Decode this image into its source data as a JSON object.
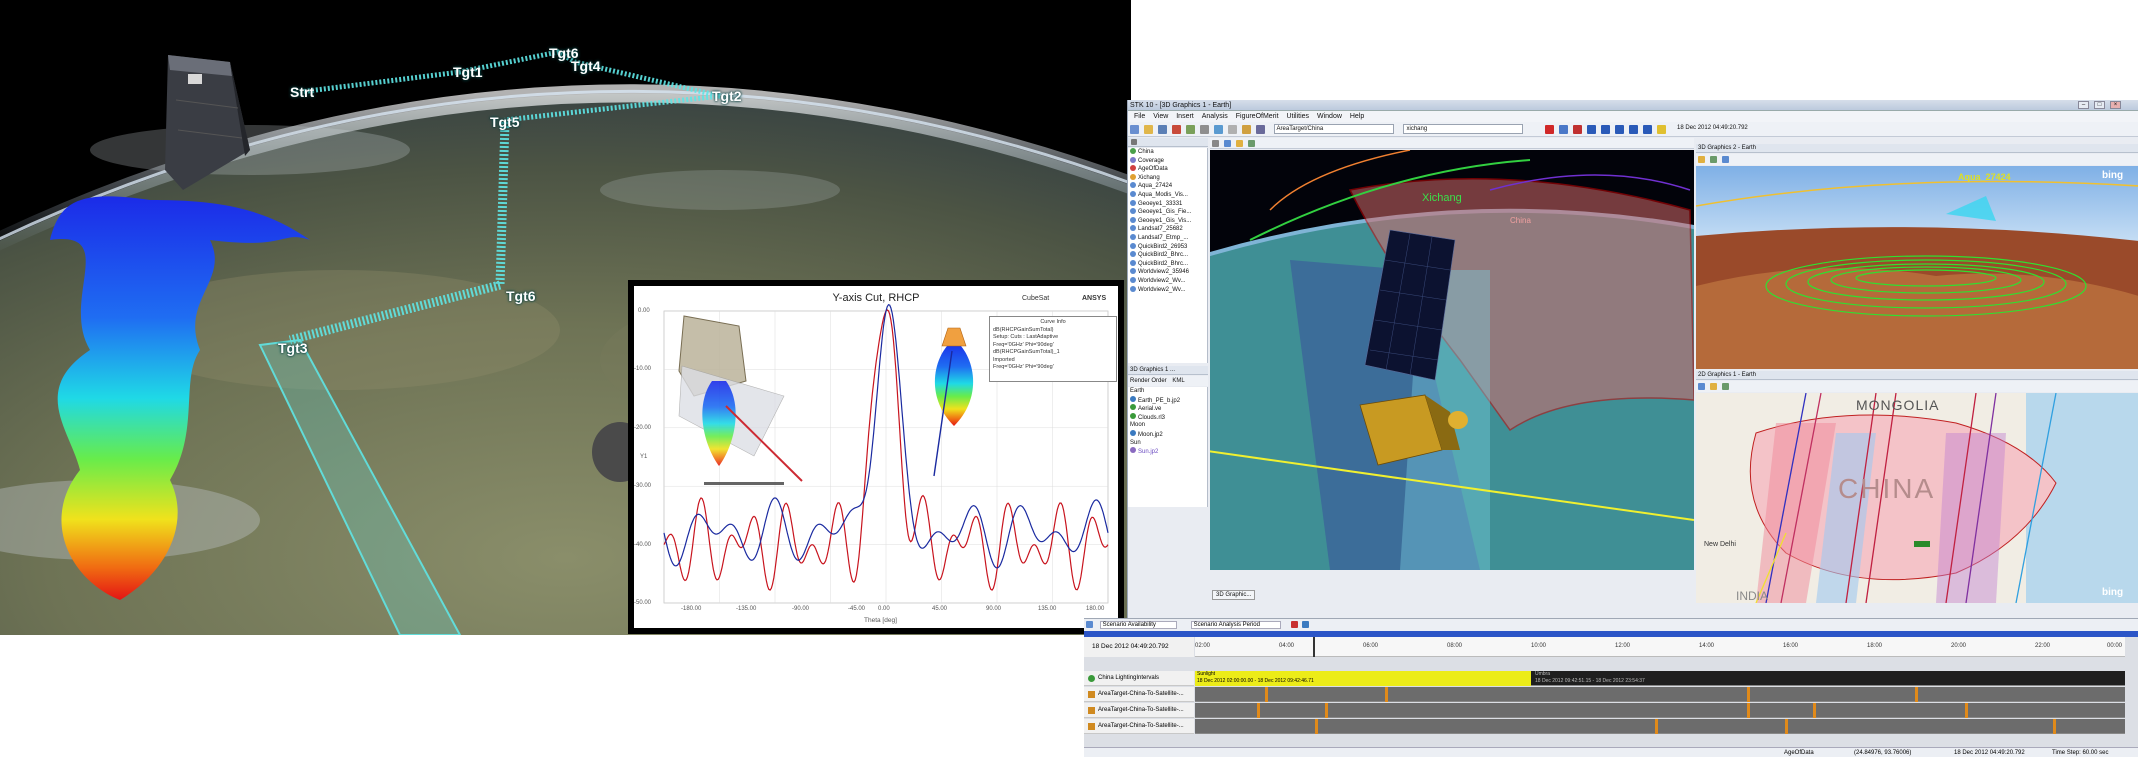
{
  "globe_scene": {
    "labels": {
      "start": "Strt",
      "tgt1": "Tgt1",
      "tgt2": "Tgt2",
      "tgt4": "Tgt4",
      "tgt5": "Tgt5",
      "tgt6_top": "Tgt6",
      "tgt6": "Tgt6",
      "tgt3": "Tgt3"
    }
  },
  "inset_chart": {
    "title": "Y-axis Cut, RHCP",
    "brand_left": "CubeSat",
    "brand_right": "ANSYS",
    "legend_title": "Curve Info",
    "legend_lines": [
      "dB(RHCPGainSumTotal)",
      "Setup: Cuts : LastAdaptive",
      "Freq='0GHz' Phi='90deg'",
      "dB(RHCPGainSumTotal)_1",
      "Imported",
      "Freq='0GHz' Phi='90deg'"
    ],
    "xlabel": "Theta [deg]",
    "ylabel": "Y1",
    "x_ticks": [
      "-180.00",
      "-135.00",
      "-90.00",
      "-45.00",
      "0.00",
      "45.00",
      "90.00",
      "135.00",
      "180.00"
    ],
    "y_ticks": [
      "0.00",
      "-10.00",
      "-20.00",
      "-30.00",
      "-40.00",
      "-50.00"
    ],
    "colors": {
      "series_a": "#1a2aa0",
      "series_b": "#c8141e"
    }
  },
  "stk": {
    "title": "STK 10 - [3D Graphics 1 - Earth]",
    "menu": [
      "File",
      "View",
      "Insert",
      "Analysis",
      "FigureOfMerit",
      "Utilities",
      "Window",
      "Help"
    ],
    "toolbar": {
      "object_select": "AreaTarget/China",
      "search_value": "xichang",
      "time": "18 Dec 2012 04:49:20.792"
    },
    "tree_items": [
      "China",
      "Coverage",
      "AgeOfData",
      "Xichang",
      "Aqua_27424",
      "Aqua_Modis_Vis...",
      "Geoeye1_33331",
      "Geoeye1_Gis_Fie...",
      "Geoeye1_Gis_Vis...",
      "Landsat7_25682",
      "Landsat7_Etmp_...",
      "QuickBird2_26953",
      "QuickBird2_Bhrc...",
      "QuickBird2_Bhrc...",
      "Worldview2_35946",
      "Worldview2_Wv...",
      "Worldview2_Wv..."
    ],
    "panel2_title": "3D Graphics 1 ...",
    "panel2_tabs": [
      "Render Order",
      "KML"
    ],
    "tree2_items": [
      "Earth",
      "Earth_PE_b.jp2",
      "Aerial.ve",
      "Clouds.rl3",
      "Moon",
      "Moon.jp2",
      "Sun",
      "Sun.jp2"
    ],
    "view3d_tab": "3D Graphic...",
    "view3d_labels": {
      "city": "Xichang",
      "area": "China"
    },
    "view_tr": {
      "title": "3D Graphics 2 - Earth",
      "label": "Aqua_27424",
      "brand": "bing"
    },
    "view_br": {
      "title": "2D Graphics 1 - Earth",
      "mongolia": "MONGOLIA",
      "china": "CHINA",
      "india": "INDIA",
      "new_delhi": "New Delhi",
      "brand": "bing"
    }
  },
  "timeline": {
    "toolbar": {
      "left": "Scenario Availability",
      "right": "Scenario Analysis Period"
    },
    "current_time": "18 Dec 2012 04:49:20.792",
    "hours": [
      "02:00",
      "04:00",
      "06:00",
      "08:00",
      "10:00",
      "12:00",
      "14:00",
      "16:00",
      "18:00",
      "20:00",
      "22:00",
      "00:00"
    ],
    "rows": [
      {
        "label": "China LightingIntervals",
        "sunlight": "Sunlight",
        "sunlight_range": "18 Dec 2012 02:00:00.00 - 18 Dec 2012 09:42:46.71",
        "umbra": "Umbra",
        "umbra_range": "18 Dec 2012 09:42:51.15 - 18 Dec 2012 23:54:37"
      },
      {
        "label": "AreaTarget-China-To-Satellite-..."
      },
      {
        "label": "AreaTarget-China-To-Satellite-..."
      },
      {
        "label": "AreaTarget-China-To-Satellite-..."
      }
    ],
    "status": {
      "object": "AgeOfData",
      "coords": "(24.84976, 93.76006)",
      "time": "18 Dec 2012 04:49:20.792",
      "step": "Time Step: 60.00 sec"
    }
  }
}
